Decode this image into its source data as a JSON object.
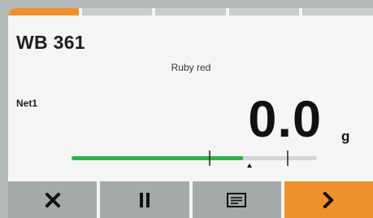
{
  "header": {
    "title": "WB 361",
    "subtitle": "Ruby red"
  },
  "tabs": [
    {
      "id": "tab-1",
      "active": true
    },
    {
      "id": "tab-2",
      "active": false
    },
    {
      "id": "tab-3",
      "active": false
    },
    {
      "id": "tab-4",
      "active": false
    },
    {
      "id": "tab-5",
      "active": false
    }
  ],
  "display": {
    "net_label": "Net1",
    "value": "0.0",
    "unit": "g"
  },
  "bargraph": {
    "fill_fraction": 0.7,
    "color": "#2fb14c",
    "track_color": "#d3d6d6"
  },
  "actions": [
    {
      "name": "cancel",
      "icon": "close-icon"
    },
    {
      "name": "pause",
      "icon": "pause-icon"
    },
    {
      "name": "info",
      "icon": "info-icon"
    },
    {
      "name": "next",
      "icon": "chevron-right-icon"
    }
  ],
  "colors": {
    "accent": "#f0902c",
    "button": "#a4aaa9",
    "screen": "#f4f5f4"
  }
}
